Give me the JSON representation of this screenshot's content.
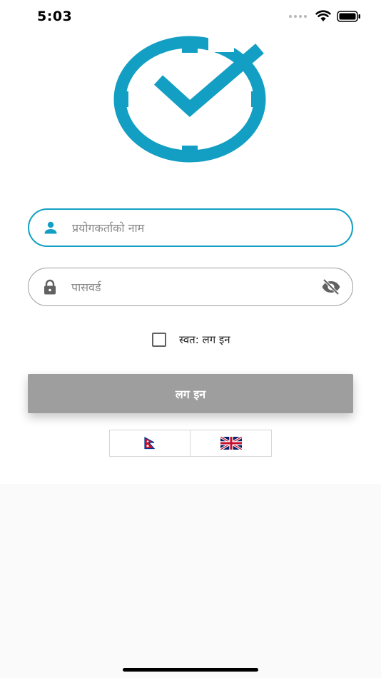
{
  "status_bar": {
    "time": "5:03"
  },
  "colors": {
    "accent": "#139fc3",
    "button_disabled": "#9e9e9e",
    "border": "#9e9e9e"
  },
  "login_form": {
    "username_placeholder": "प्रयोगकर्ताको नाम",
    "password_placeholder": "पासवर्ड",
    "remember_label": "स्वत: लग इन",
    "login_label": "लग इन"
  },
  "icons": {
    "logo": "clock-check-icon",
    "username": "person-icon",
    "password": "lock-icon",
    "toggle_visibility": "eye-off-icon"
  },
  "language_options": [
    {
      "name": "nepali",
      "flag": "nepal-flag-icon"
    },
    {
      "name": "english",
      "flag": "uk-flag-icon"
    }
  ]
}
